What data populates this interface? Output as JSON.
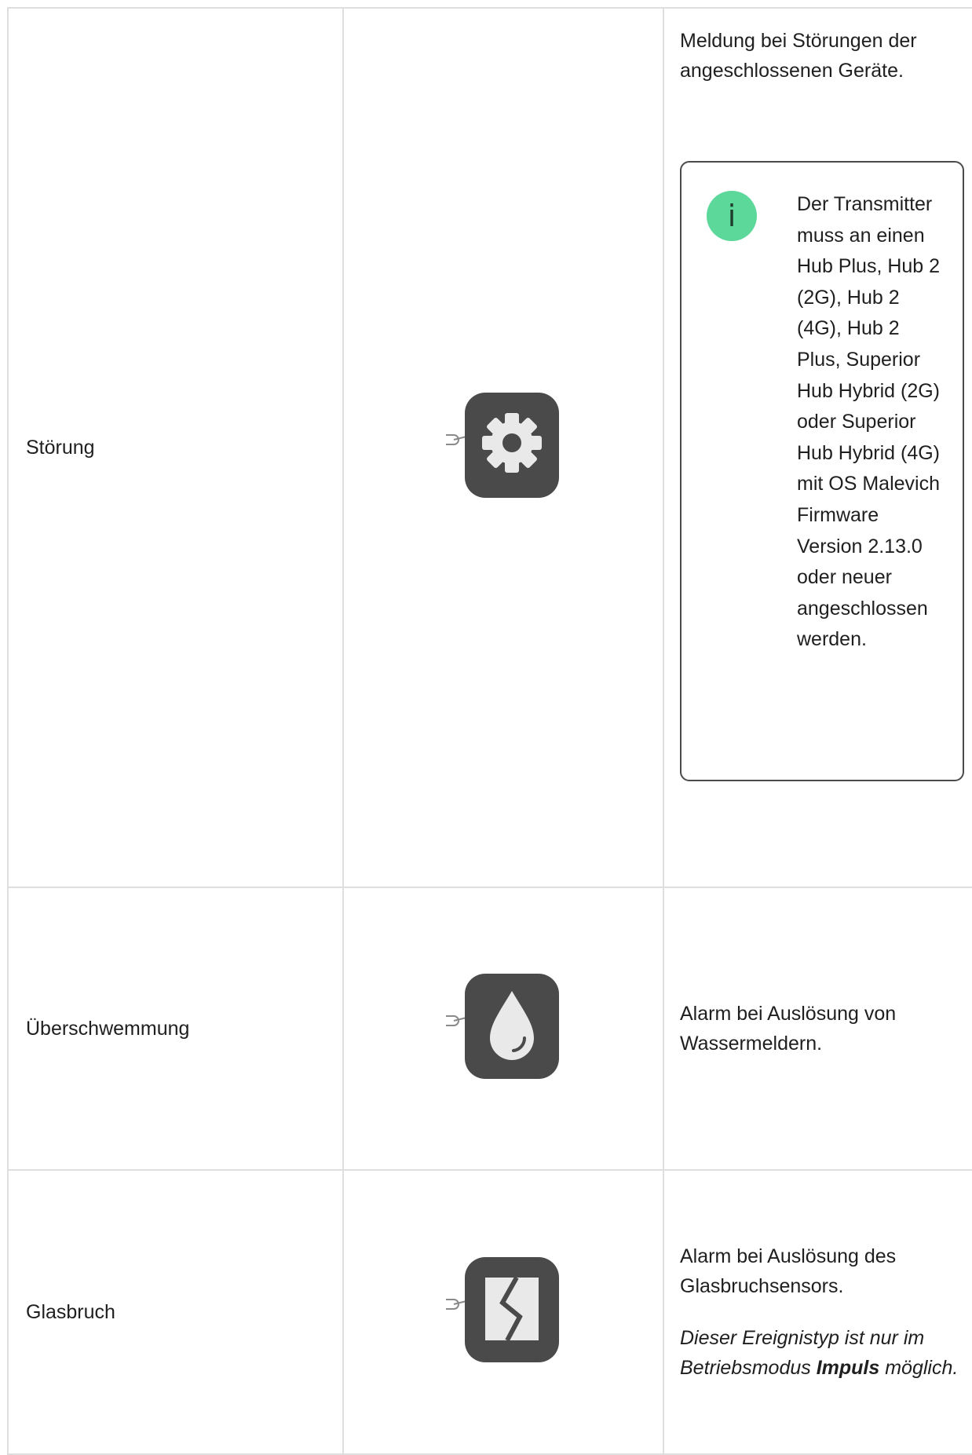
{
  "rows": [
    {
      "name": "Störung",
      "icon": "gear-icon",
      "description": "Meldung bei Störungen der angeschlossenen Geräte.",
      "note": {
        "icon": "info-icon",
        "symbol": "i",
        "text": "Der Transmitter muss an einen Hub Plus, Hub 2 (2G), Hub 2 (4G), Hub 2 Plus, Superior Hub Hybrid (2G) oder Superior Hub Hybrid (4G) mit OS Malevich Firmware Version 2.13.0 oder neuer angeschlossen werden.",
        "accent_color": "#5bd89a"
      }
    },
    {
      "name": "Überschwemmung",
      "icon": "water-drop-icon",
      "description": "Alarm bei Auslösung von Wassermeldern."
    },
    {
      "name": "Glasbruch",
      "icon": "glass-break-icon",
      "description": "Alarm bei Auslösung des Glasbruchsensors.",
      "note_italic_before": "Dieser Ereignistyp ist nur im Betriebsmodus ",
      "note_italic_bold": "Impuls",
      "note_italic_after": " möglich."
    }
  ],
  "colors": {
    "tile": "#4a4a4a",
    "glyph": "#e9e9e9",
    "border": "#dedede"
  }
}
